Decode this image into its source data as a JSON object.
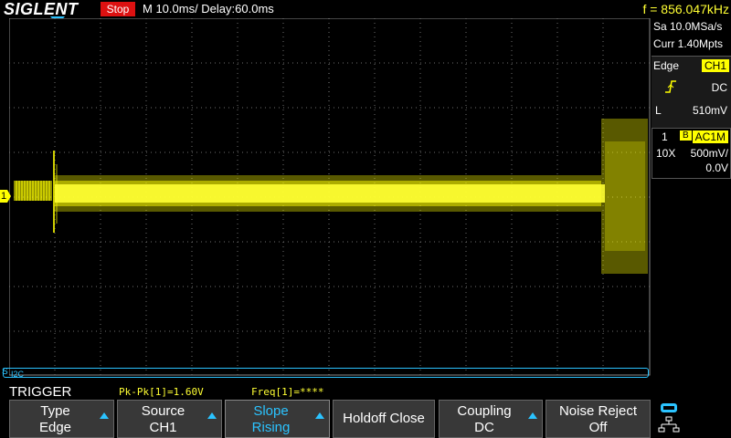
{
  "brand": "SIGLENT",
  "status": "Stop",
  "timebase": "M 10.0ms/ Delay:60.0ms",
  "frequency": "f = 856.047kHz",
  "acq": {
    "sample_rate": "Sa 10.0MSa/s",
    "memory_depth": "Curr 1.40Mpts"
  },
  "trigger_info": {
    "type": "Edge",
    "source": "CH1",
    "coupling": "DC",
    "level_label": "L",
    "level_value": "510mV"
  },
  "channel": {
    "number": "1",
    "bw_icon": "B",
    "coupling": "AC1M",
    "probe": "10X",
    "scale": "500mV/",
    "offset": "0.0V"
  },
  "ch1_marker": "1",
  "bus_label": "S",
  "bus_name": "I2C",
  "menu_title": "TRIGGER",
  "measurements": {
    "pkpk": "Pk-Pk[1]=1.60V",
    "freq": "Freq[1]=****"
  },
  "softkeys": [
    {
      "l1": "Type",
      "l2": "Edge"
    },
    {
      "l1": "Source",
      "l2": "CH1"
    },
    {
      "l1": "Slope",
      "l2": "Rising"
    },
    {
      "single": "Holdoff Close"
    },
    {
      "l1": "Coupling",
      "l2": "DC"
    },
    {
      "l1": "Noise Reject",
      "l2": "Off"
    }
  ],
  "colors": {
    "trace": "#ffff00",
    "accent": "#2bc3ff",
    "stop": "#dd1111",
    "grid": "#6e6e6e"
  },
  "icons": {
    "edge_slope": "rising-edge-icon",
    "network": "network-icon"
  }
}
